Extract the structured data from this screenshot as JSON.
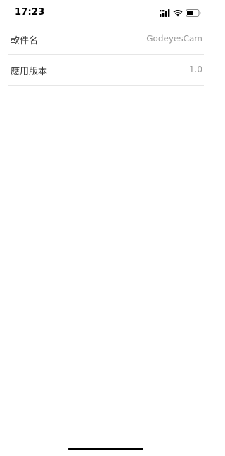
{
  "status_bar": {
    "time": "17:23",
    "icons": [
      "cellular-signal-icon",
      "wifi-icon",
      "battery-icon"
    ]
  },
  "info_list": {
    "items": [
      {
        "label": "軟件名",
        "value": "GodeyesCam"
      },
      {
        "label": "應用版本",
        "value": "1.0"
      }
    ]
  },
  "colors": {
    "label": "#333333",
    "value": "#9a9a9a",
    "divider": "#e6e6e6",
    "background": "#ffffff"
  }
}
